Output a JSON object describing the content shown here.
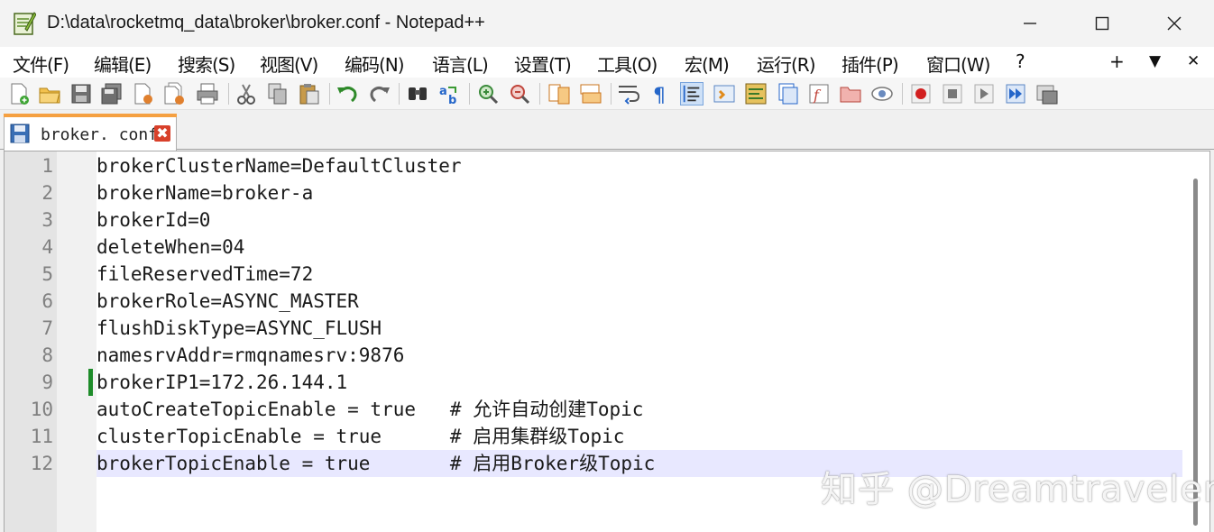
{
  "window": {
    "title": "D:\\data\\rocketmq_data\\broker\\broker.conf - Notepad++",
    "app_icon": "notepad-plus-plus-icon"
  },
  "menu": {
    "items": [
      "文件(F)",
      "编辑(E)",
      "搜索(S)",
      "视图(V)",
      "编码(N)",
      "语言(L)",
      "设置(T)",
      "工具(O)",
      "宏(M)",
      "运行(R)",
      "插件(P)",
      "窗口(W)",
      "?"
    ],
    "right": [
      "+",
      "▼",
      "✕"
    ]
  },
  "tab": {
    "label": "broker. conf",
    "close_symbol": "✖"
  },
  "editor": {
    "current_line": 12,
    "changed_line": 9,
    "lines": [
      {
        "num": "1",
        "text": "brokerClusterName=DefaultCluster"
      },
      {
        "num": "2",
        "text": "brokerName=broker-a"
      },
      {
        "num": "3",
        "text": "brokerId=0"
      },
      {
        "num": "4",
        "text": "deleteWhen=04"
      },
      {
        "num": "5",
        "text": "fileReservedTime=72"
      },
      {
        "num": "6",
        "text": "brokerRole=ASYNC_MASTER"
      },
      {
        "num": "7",
        "text": "flushDiskType=ASYNC_FLUSH"
      },
      {
        "num": "8",
        "text": "namesrvAddr=rmqnamesrv:9876"
      },
      {
        "num": "9",
        "text": "brokerIP1=172.26.144.1"
      },
      {
        "num": "10",
        "text": "autoCreateTopicEnable = true   # 允许自动创建Topic"
      },
      {
        "num": "11",
        "text": "clusterTopicEnable = true      # 启用集群级Topic"
      },
      {
        "num": "12",
        "text": "brokerTopicEnable = true       # 启用Broker级Topic"
      }
    ]
  },
  "watermark": "知乎 @Dreamtraveler"
}
